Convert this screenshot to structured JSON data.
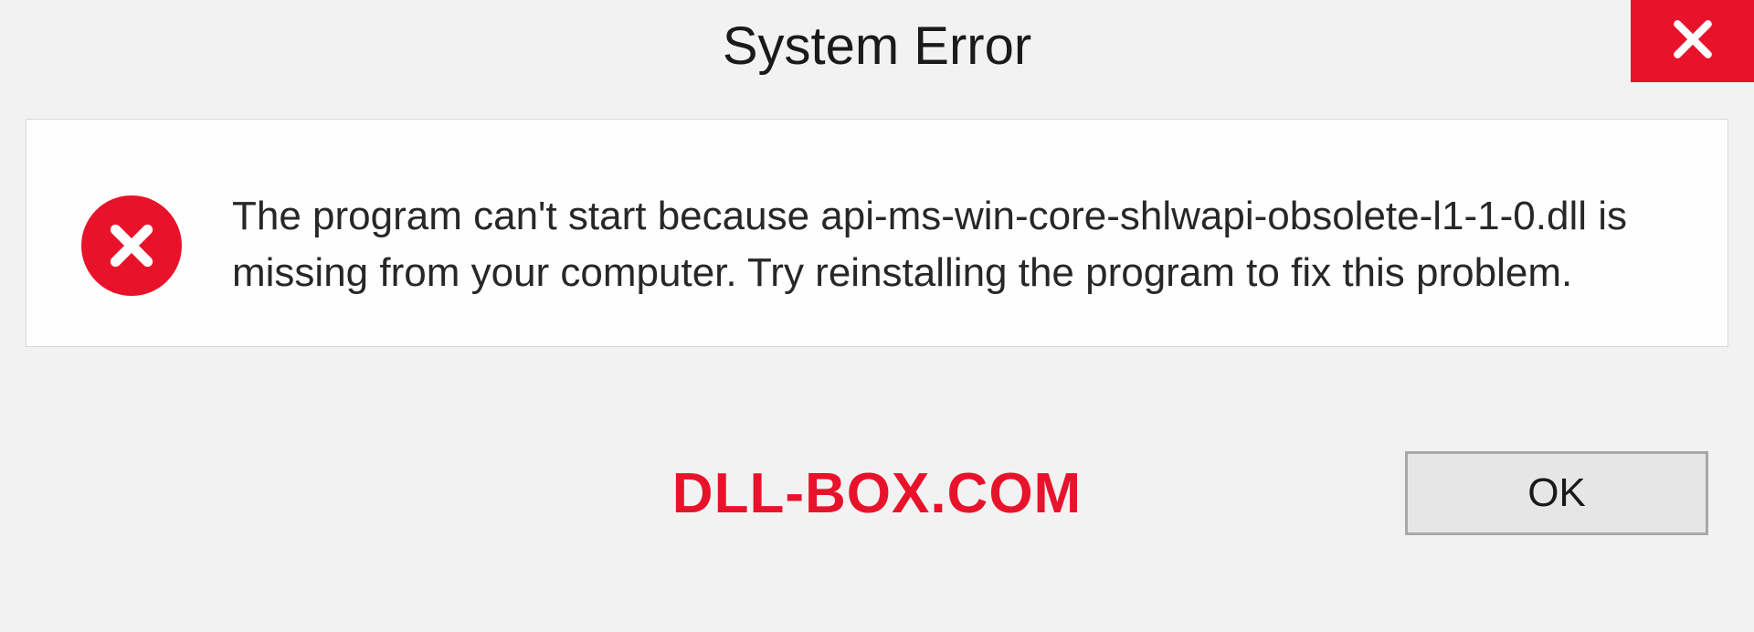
{
  "titlebar": {
    "title": "System Error"
  },
  "body": {
    "message": "The program can't start because api-ms-win-core-shlwapi-obsolete-l1-1-0.dll is missing from your computer. Try reinstalling the program to fix this problem."
  },
  "footer": {
    "watermark": "DLL-BOX.COM",
    "ok_label": "OK"
  },
  "colors": {
    "accent_red": "#e8132a",
    "bg_light": "#f2f2f2",
    "panel_white": "#fefefe",
    "btn_gray": "#e6e6e6"
  }
}
